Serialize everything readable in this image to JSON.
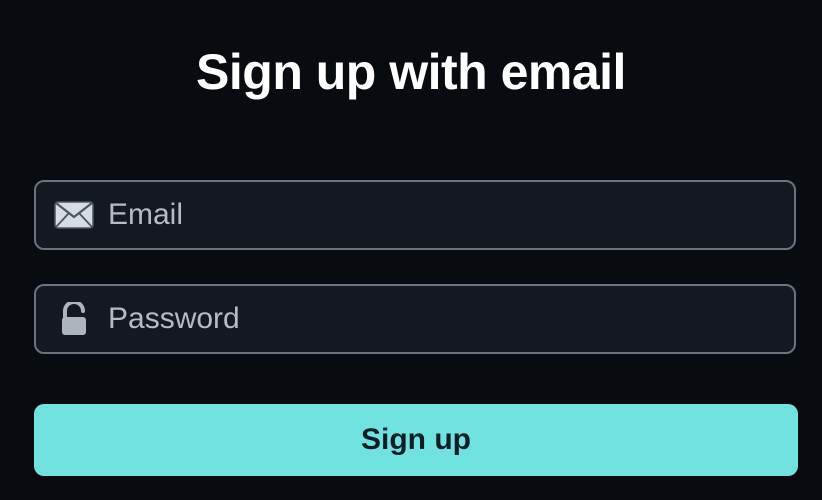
{
  "form": {
    "title": "Sign up with email",
    "email": {
      "placeholder": "Email",
      "value": "",
      "icon": "envelope-icon"
    },
    "password": {
      "placeholder": "Password",
      "value": "",
      "icon": "lock-icon"
    },
    "submit_label": "Sign up"
  },
  "colors": {
    "background": "#080b10",
    "field_background": "#141821",
    "field_border": "#6b7280",
    "button_background": "#70e2e0",
    "button_text": "#0f1e24",
    "title": "#ffffff",
    "placeholder": "#b6bcc6"
  }
}
